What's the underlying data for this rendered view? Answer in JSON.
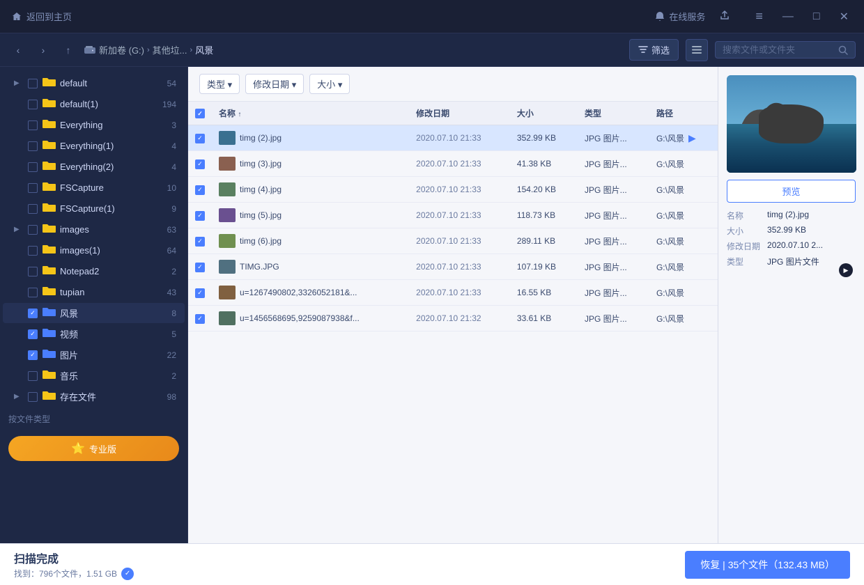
{
  "titlebar": {
    "home_label": "返回到主页",
    "online_service_label": "在线服务",
    "minimize_label": "—",
    "maximize_label": "□",
    "close_label": "✕",
    "menu_label": "≡"
  },
  "toolbar": {
    "back_label": "‹",
    "forward_label": "›",
    "up_label": "↑",
    "drive_label": "新加卷 (G:)",
    "breadcrumb": [
      "新加卷 (G:)",
      "其他垃...",
      "风景"
    ],
    "filter_label": "筛选",
    "search_placeholder": "搜索文件或文件夹"
  },
  "filter_tags": [
    {
      "label": "类型 ▾"
    },
    {
      "label": "修改日期 ▾"
    },
    {
      "label": "大小 ▾"
    }
  ],
  "table": {
    "headers": [
      "",
      "名称",
      "修改日期",
      "大小",
      "类型",
      "路径"
    ],
    "rows": [
      {
        "name": "timg (2).jpg",
        "date": "2020.07.10 21:33",
        "size": "352.99 KB",
        "type": "JPG 图片...",
        "path": "G:\\风景",
        "selected": true,
        "thumb_color": "#3a7090"
      },
      {
        "name": "timg (3).jpg",
        "date": "2020.07.10 21:33",
        "size": "41.38 KB",
        "type": "JPG 图片...",
        "path": "G:\\风景",
        "selected": true,
        "thumb_color": "#8a6050"
      },
      {
        "name": "timg (4).jpg",
        "date": "2020.07.10 21:33",
        "size": "154.20 KB",
        "type": "JPG 图片...",
        "path": "G:\\风景",
        "selected": true,
        "thumb_color": "#5a8060"
      },
      {
        "name": "timg (5).jpg",
        "date": "2020.07.10 21:33",
        "size": "118.73 KB",
        "type": "JPG 图片...",
        "path": "G:\\风景",
        "selected": true,
        "thumb_color": "#6a5090"
      },
      {
        "name": "timg (6).jpg",
        "date": "2020.07.10 21:33",
        "size": "289.11 KB",
        "type": "JPG 图片...",
        "path": "G:\\风景",
        "selected": true,
        "thumb_color": "#709050"
      },
      {
        "name": "TIMG.JPG",
        "date": "2020.07.10 21:33",
        "size": "107.19 KB",
        "type": "JPG 图片...",
        "path": "G:\\风景",
        "selected": true,
        "thumb_color": "#507080"
      },
      {
        "name": "u=1267490802,3326052181&...",
        "date": "2020.07.10 21:33",
        "size": "16.55 KB",
        "type": "JPG 图片...",
        "path": "G:\\风景",
        "selected": true,
        "thumb_color": "#806040"
      },
      {
        "name": "u=1456568695,9259087938&f...",
        "date": "2020.07.10 21:32",
        "size": "33.61 KB",
        "type": "JPG 图片...",
        "path": "G:\\风景",
        "selected": true,
        "thumb_color": "#507060"
      }
    ]
  },
  "preview": {
    "btn_label": "预览",
    "meta": {
      "name_label": "名称",
      "name_value": "timg (2).jpg",
      "size_label": "大小",
      "size_value": "352.99 KB",
      "date_label": "修改日期",
      "date_value": "2020.07.10 2...",
      "type_label": "类型",
      "type_value": "JPG 图片文件"
    }
  },
  "sidebar": {
    "items": [
      {
        "name": "default",
        "count": "54",
        "expandable": true,
        "checked": false
      },
      {
        "name": "default(1)",
        "count": "194",
        "expandable": false,
        "checked": false
      },
      {
        "name": "Everything",
        "count": "3",
        "expandable": false,
        "checked": false
      },
      {
        "name": "Everything(1)",
        "count": "4",
        "expandable": false,
        "checked": false
      },
      {
        "name": "Everything(2)",
        "count": "4",
        "expandable": false,
        "checked": false
      },
      {
        "name": "FSCapture",
        "count": "10",
        "expandable": false,
        "checked": false
      },
      {
        "name": "FSCapture(1)",
        "count": "9",
        "expandable": false,
        "checked": false
      },
      {
        "name": "images",
        "count": "63",
        "expandable": true,
        "checked": false
      },
      {
        "name": "images(1)",
        "count": "64",
        "expandable": false,
        "checked": false
      },
      {
        "name": "Notepad2",
        "count": "2",
        "expandable": false,
        "checked": false
      },
      {
        "name": "tupian",
        "count": "43",
        "expandable": false,
        "checked": false
      },
      {
        "name": "风景",
        "count": "8",
        "expandable": false,
        "checked": true,
        "selected": true
      },
      {
        "name": "视频",
        "count": "5",
        "expandable": false,
        "checked": true
      },
      {
        "name": "图片",
        "count": "22",
        "expandable": false,
        "checked": true
      },
      {
        "name": "音乐",
        "count": "2",
        "expandable": false,
        "checked": false
      },
      {
        "name": "存在文件",
        "count": "98",
        "expandable": true,
        "checked": false
      }
    ],
    "footer_label": "按文件类型",
    "pro_btn_label": "专业版"
  },
  "statusbar": {
    "title": "扫描完成",
    "sub_label": "找到：796个文件，1.51 GB",
    "recover_btn": "恢复 | 35个文件（132.43 MB）"
  }
}
